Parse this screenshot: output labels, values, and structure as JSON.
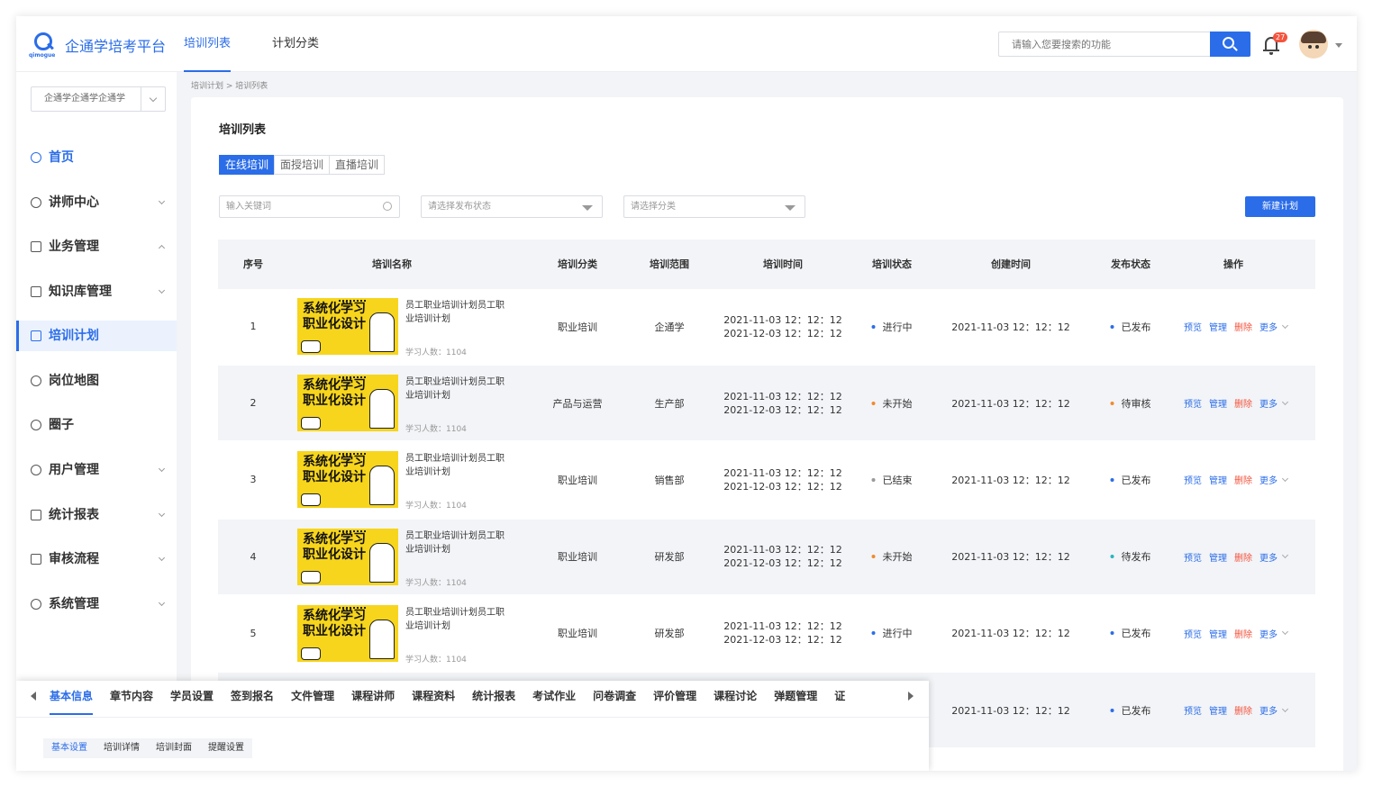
{
  "app": {
    "logo_sub": "qimogue",
    "title": "企通学培考平台"
  },
  "topnav": [
    {
      "label": "培训列表",
      "active": true
    },
    {
      "label": "计划分类",
      "active": false
    }
  ],
  "search": {
    "placeholder": "请输入您要搜索的功能"
  },
  "notifications": {
    "count": "27"
  },
  "sidebar": {
    "org_select": "企通学企通学企通学",
    "items": [
      {
        "label": "首页",
        "icon": "home-icon"
      },
      {
        "label": "讲师中心",
        "icon": "user-icon"
      },
      {
        "label": "业务管理",
        "icon": "briefcase-icon"
      },
      {
        "label": "知识库管理",
        "icon": "book-icon"
      },
      {
        "label": "培训计划",
        "icon": "calendar-icon"
      },
      {
        "label": "岗位地图",
        "icon": "person-icon"
      },
      {
        "label": "圈子",
        "icon": "circle-icon"
      },
      {
        "label": "用户管理",
        "icon": "users-icon"
      },
      {
        "label": "统计报表",
        "icon": "chart-icon"
      },
      {
        "label": "审核流程",
        "icon": "audit-icon"
      },
      {
        "label": "系统管理",
        "icon": "gear-icon"
      }
    ]
  },
  "breadcrumb": "培训计划 > 培训列表",
  "panel": {
    "title": "培训列表",
    "segments": [
      "在线培训",
      "面授培训",
      "直播培训"
    ],
    "filters": {
      "keyword_placeholder": "输入关键词",
      "publish_status_placeholder": "请选择发布状态",
      "category_placeholder": "请选择分类"
    },
    "new_button": "新建计划"
  },
  "table": {
    "headers": [
      "序号",
      "培训名称",
      "培训分类",
      "培训范围",
      "培训时间",
      "培训状态",
      "创建时间",
      "发布状态",
      "操作"
    ],
    "thumb_text": "系统化学习\n职业化设计",
    "ops": [
      "预览",
      "管理",
      "删除",
      "更多"
    ],
    "rows": [
      {
        "no": "1",
        "name": "员工职业培训计划员工职业培训计划",
        "learners": "学习人数：1104",
        "category": "职业培训",
        "scope": "企通学",
        "start": "2021-11-03 12：12：12",
        "end": "2021-12-03 12：12：12",
        "status": "进行中",
        "status_color": "#2b6de8",
        "created": "2021-11-03 12：12：12",
        "publish": "已发布",
        "publish_color": "#2b6de8"
      },
      {
        "no": "2",
        "name": "员工职业培训计划员工职业培训计划",
        "learners": "学习人数：1104",
        "category": "产品与运营",
        "scope": "生产部",
        "start": "2021-11-03 12：12：12",
        "end": "2021-12-03 12：12：12",
        "status": "未开始",
        "status_color": "#f28a2c",
        "created": "2021-11-03 12：12：12",
        "publish": "待审核",
        "publish_color": "#f28a2c"
      },
      {
        "no": "3",
        "name": "员工职业培训计划员工职业培训计划",
        "learners": "学习人数：1104",
        "category": "职业培训",
        "scope": "销售部",
        "start": "2021-11-03 12：12：12",
        "end": "2021-12-03 12：12：12",
        "status": "已结束",
        "status_color": "#999999",
        "created": "2021-11-03 12：12：12",
        "publish": "已发布",
        "publish_color": "#2b6de8"
      },
      {
        "no": "4",
        "name": "员工职业培训计划员工职业培训计划",
        "learners": "学习人数：1104",
        "category": "职业培训",
        "scope": "研发部",
        "start": "2021-11-03 12：12：12",
        "end": "2021-12-03 12：12：12",
        "status": "未开始",
        "status_color": "#f28a2c",
        "created": "2021-11-03 12：12：12",
        "publish": "待发布",
        "publish_color": "#2ab3c0"
      },
      {
        "no": "5",
        "name": "员工职业培训计划员工职业培训计划",
        "learners": "学习人数：1104",
        "category": "职业培训",
        "scope": "研发部",
        "start": "2021-11-03 12：12：12",
        "end": "2021-12-03 12：12：12",
        "status": "进行中",
        "status_color": "#2b6de8",
        "created": "2021-11-03 12：12：12",
        "publish": "已发布",
        "publish_color": "#2b6de8"
      },
      {
        "no": "",
        "name": "",
        "learners": "",
        "category": "",
        "scope": "",
        "start": "",
        "end": "",
        "status": "",
        "status_color": "",
        "created": "2021-11-03 12：12：12",
        "publish": "已发布",
        "publish_color": "#2b6de8"
      }
    ]
  },
  "overlay": {
    "tabs": [
      "基本信息",
      "章节内容",
      "学员设置",
      "签到报名",
      "文件管理",
      "课程讲师",
      "课程资料",
      "统计报表",
      "考试作业",
      "问卷调查",
      "评价管理",
      "课程讨论",
      "弹题管理",
      "证"
    ],
    "subtabs": [
      "基本设置",
      "培训详情",
      "培训封面",
      "提醒设置"
    ]
  }
}
